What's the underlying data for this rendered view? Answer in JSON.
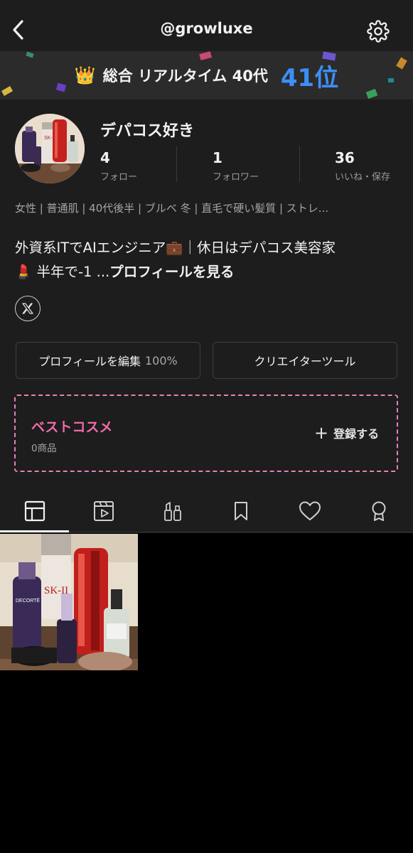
{
  "header": {
    "handle": "@growluxe"
  },
  "banner": {
    "crown": "👑",
    "text": "総合 リアルタイム 40代",
    "rank": "41位"
  },
  "profile": {
    "name": "デパコス好き",
    "stats": [
      {
        "count": "4",
        "label": "フォロー"
      },
      {
        "count": "1",
        "label": "フォロワー"
      },
      {
        "count": "36",
        "label": "いいね・保存"
      }
    ],
    "attributes": "女性 | 普通肌 | 40代後半 | ブルベ 冬 | 直毛で硬い髪質 | ストレ...",
    "bio_line1": "外資系ITでAIエンジニア💼｜休日はデパコス美容家",
    "bio_line2": "💄 半年で-1 ...",
    "bio_more": "プロフィールを見る"
  },
  "buttons": {
    "edit_label": "プロフィールを編集",
    "edit_percent": "100%",
    "creator_label": "クリエイターツール"
  },
  "best_cosme": {
    "title": "ベストコスメ",
    "count": "0商品",
    "register_label": "登録する"
  },
  "tabs": [
    {
      "icon": "grid-icon",
      "active": true
    },
    {
      "icon": "video-icon",
      "active": false
    },
    {
      "icon": "cosmetics-icon",
      "active": false
    },
    {
      "icon": "bookmark-icon",
      "active": false
    },
    {
      "icon": "heart-icon",
      "active": false
    },
    {
      "icon": "award-icon",
      "active": false
    }
  ],
  "colors": {
    "background": "#1d1d1d",
    "rank": "#3d8ff5",
    "accent_pink": "#f06aaa",
    "dashed_border": "#e87fb8"
  }
}
